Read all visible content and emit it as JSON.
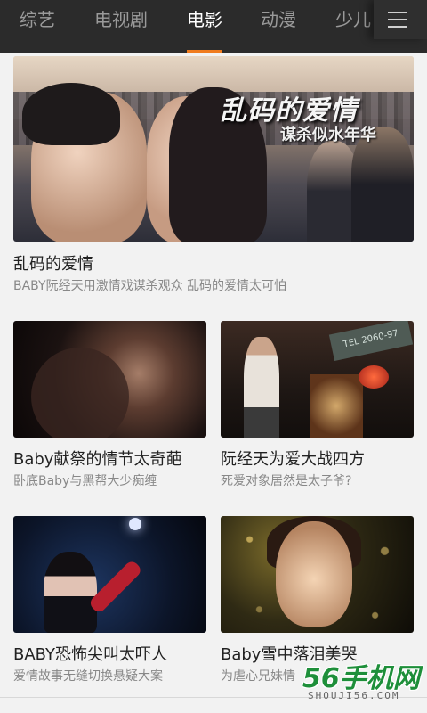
{
  "tabs": [
    {
      "label": "综艺",
      "active": false
    },
    {
      "label": "电视剧",
      "active": false
    },
    {
      "label": "电影",
      "active": true
    },
    {
      "label": "动漫",
      "active": false
    },
    {
      "label": "少儿",
      "active": false
    }
  ],
  "colors": {
    "accent": "#f07b1d",
    "topbar": "#2b2b2b",
    "background": "#f2f2f2"
  },
  "icons": {
    "menu": "hamburger-menu-icon"
  },
  "featured": {
    "poster_title": "乱码的爱情",
    "poster_subtitle": "谋杀似水年华",
    "title": "乱码的爱情",
    "subtitle": "BABY阮经天用激情戏谋杀观众 乱码的爱情太可怕"
  },
  "items": [
    {
      "title": "Baby献祭的情节太奇葩",
      "subtitle": "卧底Baby与黑帮大少痴缠"
    },
    {
      "title": "阮经天为爱大战四方",
      "subtitle": "死爱对象居然是太子爷?",
      "poster_sign": "TEL 2060-97"
    },
    {
      "title": "BABY恐怖尖叫太吓人",
      "subtitle": "爱情故事无缝切换悬疑大案"
    },
    {
      "title": "Baby雪中落泪美哭",
      "subtitle": "为虐心兄妹情"
    }
  ],
  "watermark": {
    "brand": "56手机网",
    "domain": "SHOUJI56.COM"
  }
}
